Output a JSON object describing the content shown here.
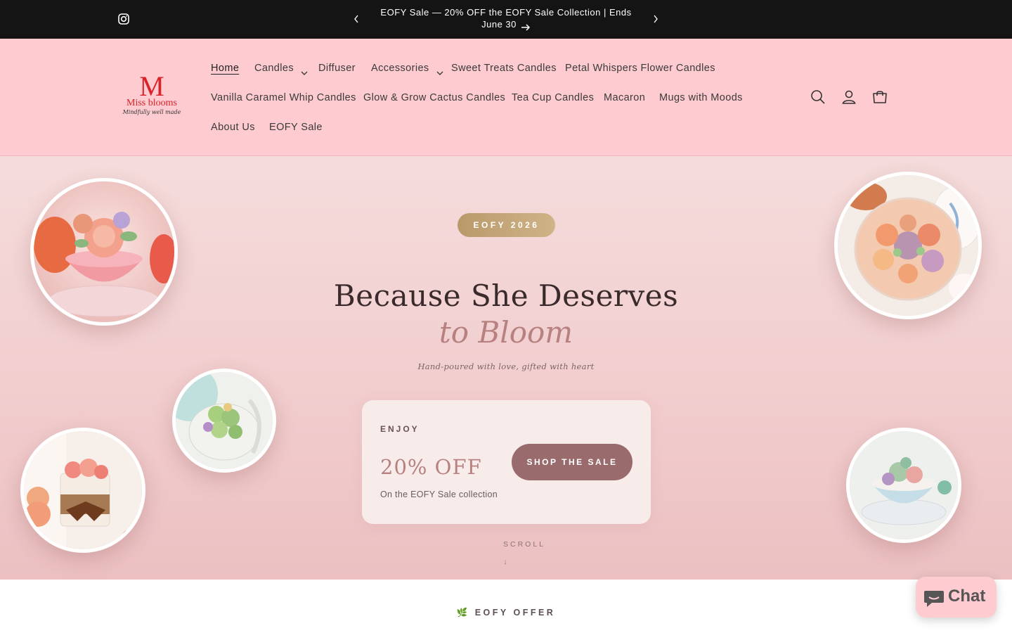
{
  "announcement": {
    "message": "EOFY Sale — 20% OFF the EOFY Sale Collection | Ends June 30"
  },
  "brand": {
    "logo_mark": "M",
    "logo_name": "Miss blooms",
    "logo_tagline": "Mindfully well made"
  },
  "nav": {
    "items": [
      {
        "label": "Home"
      },
      {
        "label": "Candles"
      },
      {
        "label": "Diffuser"
      },
      {
        "label": "Accessories"
      },
      {
        "label": "Sweet Treats Candles"
      },
      {
        "label": "Petal Whispers Flower Candles"
      },
      {
        "label": "Vanilla Caramel Whip Candles"
      },
      {
        "label": "Glow & Grow Cactus Candles"
      },
      {
        "label": "Tea Cup Candles"
      },
      {
        "label": "Macaron"
      },
      {
        "label": "Mugs with Moods"
      },
      {
        "label": "About Us"
      },
      {
        "label": "EOFY Sale"
      }
    ]
  },
  "hero": {
    "badge": "EOFY 2026",
    "headline": "Because She Deserves",
    "headline_italic": "to Bloom",
    "tagline": "Hand-poured with love, gifted with heart",
    "card": {
      "eyebrow": "ENJOY",
      "offer": "20% OFF",
      "subtext": "On the EOFY Sale collection",
      "button": "SHOP THE SALE"
    },
    "scroll_label": "SCROLL",
    "scroll_arrow": "↓"
  },
  "section": {
    "offer_label": "🌿 EOFY OFFER"
  },
  "chat": {
    "label": "Chat"
  },
  "colors": {
    "announce_bg": "#141414",
    "header_bg": "#fecbd0",
    "accent": "#b78180",
    "button": "#9a6b6c",
    "badge_gold": "#c4a77a"
  }
}
